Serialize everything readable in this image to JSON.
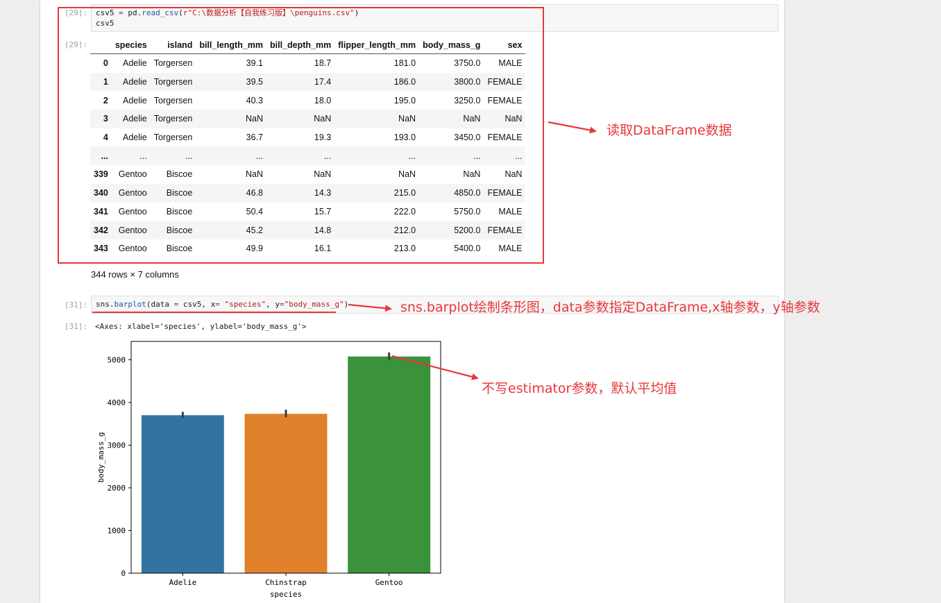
{
  "cells": {
    "read": {
      "prompt_in": "[29]:",
      "line1_a": "csv5 ",
      "line1_eq": "=",
      "line1_b": " pd.",
      "line1_fn": "read_csv",
      "line1_c": "(",
      "line1_str": "r\"C:\\数据分析【自我练习版】\\penguins.csv\"",
      "line1_d": ")",
      "line2": "csv5",
      "prompt_out": "[29]:"
    },
    "plot": {
      "prompt_in": "[31]:",
      "code_a": "sns.",
      "code_fn": "barplot",
      "code_b": "(data ",
      "code_eq1": "=",
      "code_c": " csv5, x",
      "code_eq2": "=",
      "code_d": " ",
      "code_s1": "\"species\"",
      "code_e": ", y",
      "code_eq3": "=",
      "code_s2": "\"body_mass_g\"",
      "code_f": ")",
      "prompt_out": "[31]:",
      "output_text": "<Axes: xlabel='species', ylabel='body_mass_g'>"
    }
  },
  "dataframe": {
    "columns": [
      "",
      "species",
      "island",
      "bill_length_mm",
      "bill_depth_mm",
      "flipper_length_mm",
      "body_mass_g",
      "sex"
    ],
    "rows": [
      [
        "0",
        "Adelie",
        "Torgersen",
        "39.1",
        "18.7",
        "181.0",
        "3750.0",
        "MALE"
      ],
      [
        "1",
        "Adelie",
        "Torgersen",
        "39.5",
        "17.4",
        "186.0",
        "3800.0",
        "FEMALE"
      ],
      [
        "2",
        "Adelie",
        "Torgersen",
        "40.3",
        "18.0",
        "195.0",
        "3250.0",
        "FEMALE"
      ],
      [
        "3",
        "Adelie",
        "Torgersen",
        "NaN",
        "NaN",
        "NaN",
        "NaN",
        "NaN"
      ],
      [
        "4",
        "Adelie",
        "Torgersen",
        "36.7",
        "19.3",
        "193.0",
        "3450.0",
        "FEMALE"
      ],
      [
        "...",
        "...",
        "...",
        "...",
        "...",
        "...",
        "...",
        "..."
      ],
      [
        "339",
        "Gentoo",
        "Biscoe",
        "NaN",
        "NaN",
        "NaN",
        "NaN",
        "NaN"
      ],
      [
        "340",
        "Gentoo",
        "Biscoe",
        "46.8",
        "14.3",
        "215.0",
        "4850.0",
        "FEMALE"
      ],
      [
        "341",
        "Gentoo",
        "Biscoe",
        "50.4",
        "15.7",
        "222.0",
        "5750.0",
        "MALE"
      ],
      [
        "342",
        "Gentoo",
        "Biscoe",
        "45.2",
        "14.8",
        "212.0",
        "5200.0",
        "FEMALE"
      ],
      [
        "343",
        "Gentoo",
        "Biscoe",
        "49.9",
        "16.1",
        "213.0",
        "5400.0",
        "MALE"
      ]
    ],
    "shape_text": "344 rows × 7 columns"
  },
  "annotations": {
    "read_df": "读取DataFrame数据",
    "barplot": "sns.barplot绘制条形图，data参数指定DataFrame,x轴参数，y轴参数",
    "estimator": "不写estimator参数，默认平均值"
  },
  "colors": {
    "annotation": "#e8373a"
  },
  "chart_data": {
    "type": "bar",
    "categories": [
      "Adelie",
      "Chinstrap",
      "Gentoo"
    ],
    "values": [
      3701,
      3733,
      5076
    ],
    "error_low": [
      3630,
      3650,
      4995
    ],
    "error_high": [
      3780,
      3830,
      5170
    ],
    "colors": [
      "#3274a1",
      "#e1812c",
      "#3a923a"
    ],
    "xlabel": "species",
    "ylabel": "body_mass_g",
    "ylim": [
      0,
      5430
    ],
    "yticks": [
      0,
      1000,
      2000,
      3000,
      4000,
      5000
    ],
    "grid": false
  }
}
